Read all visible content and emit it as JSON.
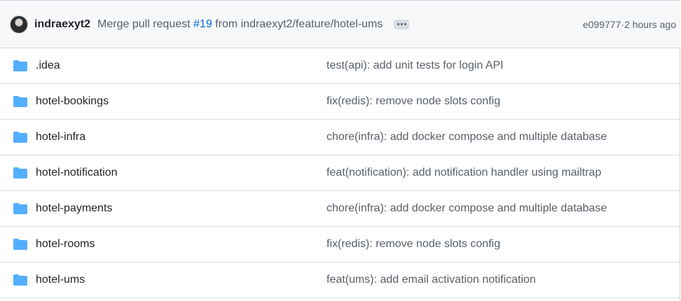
{
  "latest_commit": {
    "author": "indraexyt2",
    "message_prefix": "Merge pull request ",
    "pr_number": "#19",
    "message_suffix": " from indraexyt2/feature/hotel-ums",
    "hash": "e099777",
    "separator": " · ",
    "time": "2 hours ago"
  },
  "files": [
    {
      "name": ".idea",
      "message": "test(api): add unit tests for login API",
      "icon": "folder-icon"
    },
    {
      "name": "hotel-bookings",
      "message": "fix(redis): remove node slots config",
      "icon": "folder-icon"
    },
    {
      "name": "hotel-infra",
      "message": "chore(infra): add docker compose and multiple database",
      "icon": "folder-icon"
    },
    {
      "name": "hotel-notification",
      "message": "feat(notification): add notification handler using mailtrap",
      "icon": "folder-icon"
    },
    {
      "name": "hotel-payments",
      "message": "chore(infra): add docker compose and multiple database",
      "icon": "folder-icon"
    },
    {
      "name": "hotel-rooms",
      "message": "fix(redis): remove node slots config",
      "icon": "folder-icon"
    },
    {
      "name": "hotel-ums",
      "message": "feat(ums): add email activation notification",
      "icon": "folder-icon"
    }
  ],
  "colors": {
    "folder": "#54aeff",
    "link": "#0969da",
    "muted": "#57606a"
  }
}
